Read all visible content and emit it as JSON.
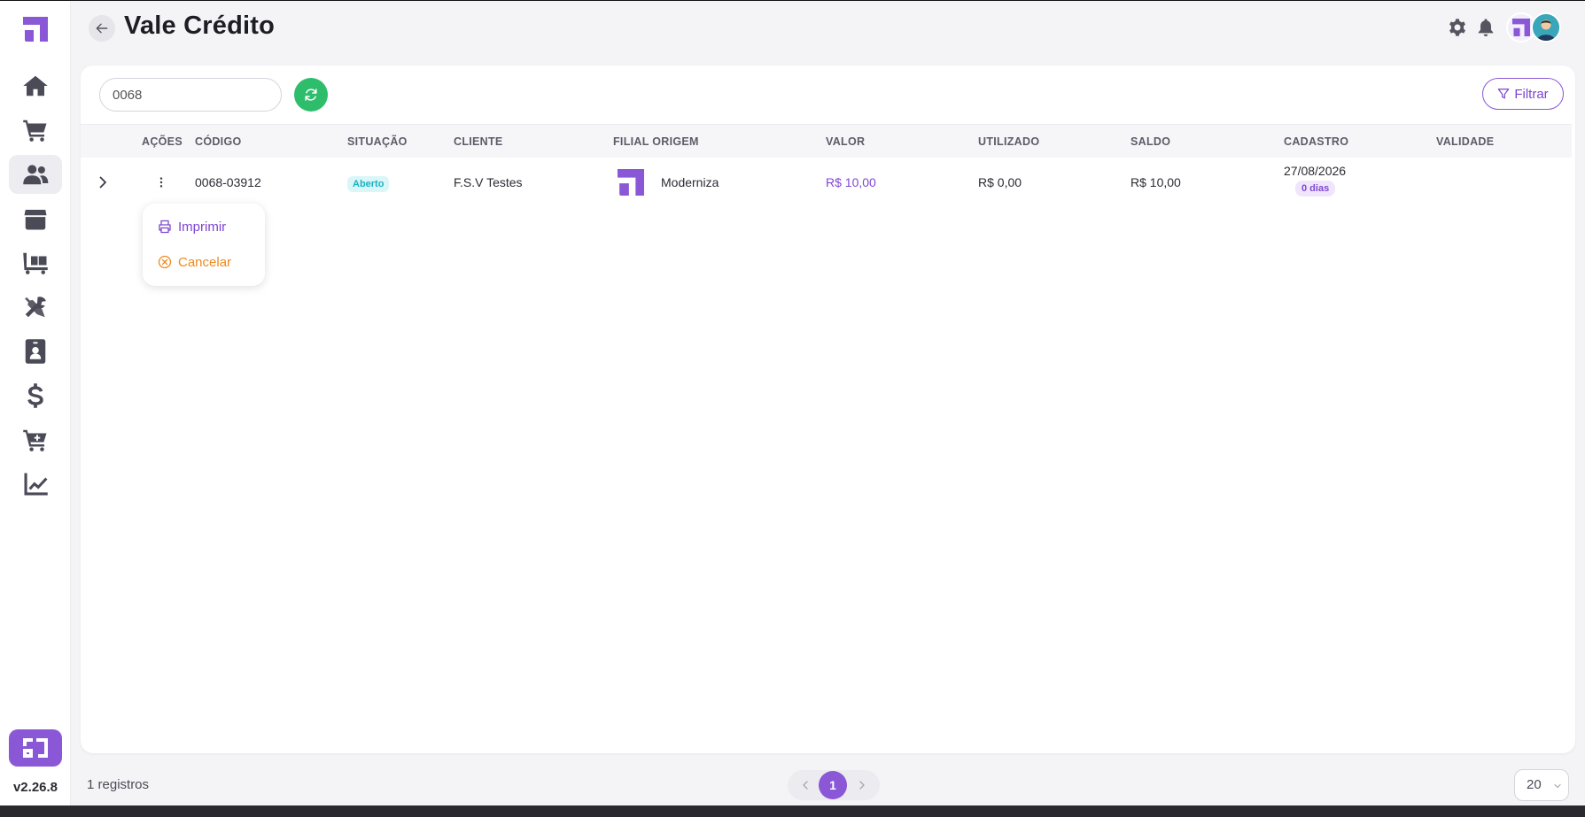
{
  "app": {
    "title": "Vale Crédito",
    "version": "v2.26.8",
    "brand_color": "#8a57d6"
  },
  "sidebar": {
    "items": [
      {
        "name": "home-icon",
        "active": false
      },
      {
        "name": "cart-icon",
        "active": false
      },
      {
        "name": "users-icon",
        "active": true
      },
      {
        "name": "box-icon",
        "active": false
      },
      {
        "name": "dolly-icon",
        "active": false
      },
      {
        "name": "tools-icon",
        "active": false
      },
      {
        "name": "id-badge-icon",
        "active": false
      },
      {
        "name": "dollar-icon",
        "active": false
      },
      {
        "name": "cart-plus-icon",
        "active": false
      },
      {
        "name": "chart-line-icon",
        "active": false
      }
    ]
  },
  "header": {
    "icons": [
      "gear-icon",
      "bell-icon"
    ]
  },
  "toolbar": {
    "search_value": "0068",
    "filter_label": "Filtrar"
  },
  "table": {
    "columns": [
      "AÇÕES",
      "CÓDIGO",
      "SITUAÇÃO",
      "CLIENTE",
      "FILIAL ORIGEM",
      "VALOR",
      "UTILIZADO",
      "SALDO",
      "CADASTRO",
      "VALIDADE"
    ],
    "rows": [
      {
        "codigo": "0068-03912",
        "situacao": "Aberto",
        "cliente": "F.S.V Testes",
        "filial": "Moderniza",
        "valor": "R$ 10,00",
        "utilizado": "R$ 0,00",
        "saldo": "R$ 10,00",
        "cadastro": "27/08/2026",
        "cadastro_badge": "0 dias",
        "validade": ""
      }
    ]
  },
  "actions_menu": {
    "print_label": "Imprimir",
    "cancel_label": "Cancelar"
  },
  "footer": {
    "count_label": "1 registros",
    "current_page": "1",
    "page_size": "20"
  }
}
